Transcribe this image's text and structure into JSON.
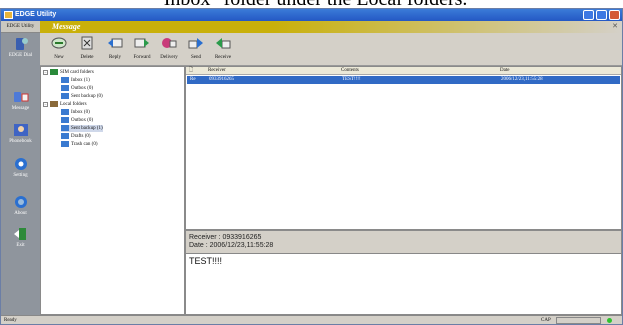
{
  "document": {
    "heading_text": "\"Inbox\" folder under the Local folders."
  },
  "window": {
    "title": "EDGE Utility"
  },
  "sidebar": {
    "header": "EDGE Utility",
    "items": [
      {
        "label": "EDGE Dial",
        "icon": "dial-icon"
      },
      {
        "label": "Message",
        "icon": "message-icon"
      },
      {
        "label": "Phonebook",
        "icon": "phonebook-icon"
      },
      {
        "label": "Setting",
        "icon": "setting-icon"
      },
      {
        "label": "About",
        "icon": "about-icon"
      },
      {
        "label": "Exit",
        "icon": "exit-icon"
      }
    ]
  },
  "pane": {
    "title": "Message"
  },
  "toolbar": {
    "new_label": "New",
    "delete_label": "Delete",
    "reply_label": "Reply",
    "forward_label": "Forward",
    "delivery_label": "Delivery",
    "send_label": "Send",
    "receive_label": "Receive"
  },
  "tree": {
    "sim_root": "SIM card folders",
    "sim_inbox": "Inbox",
    "sim_inbox_count": "(1)",
    "sim_outbox": "Outbox",
    "sim_outbox_count": "(0)",
    "sim_sent": "Sent backup",
    "sim_sent_count": "(0)",
    "local_root": "Local folders",
    "local_inbox": "Inbox",
    "local_inbox_count": "(0)",
    "local_outbox": "Outbox",
    "local_outbox_count": "(0)",
    "local_sent": "Sent backup",
    "local_sent_count": "(1)",
    "local_drafts": "Drafts",
    "local_drafts_count": "(0)",
    "local_trash": "Trash can",
    "local_trash_count": "(0)"
  },
  "message_list": {
    "columns": {
      "receiver": "Receiver",
      "contents": "Contents",
      "date": "Date"
    },
    "rows": [
      {
        "status": "Re",
        "receiver": "0933916265",
        "contents": "TEST!!!!",
        "date": "2006/12/23,11:55:28"
      }
    ]
  },
  "detail": {
    "receiver_line": "Receiver : 0933916265",
    "date_line": "Date : 2006/12/23,11:55:28",
    "body": "TEST!!!!"
  },
  "status_bar": {
    "ready": "Ready",
    "cap": "CAP"
  }
}
